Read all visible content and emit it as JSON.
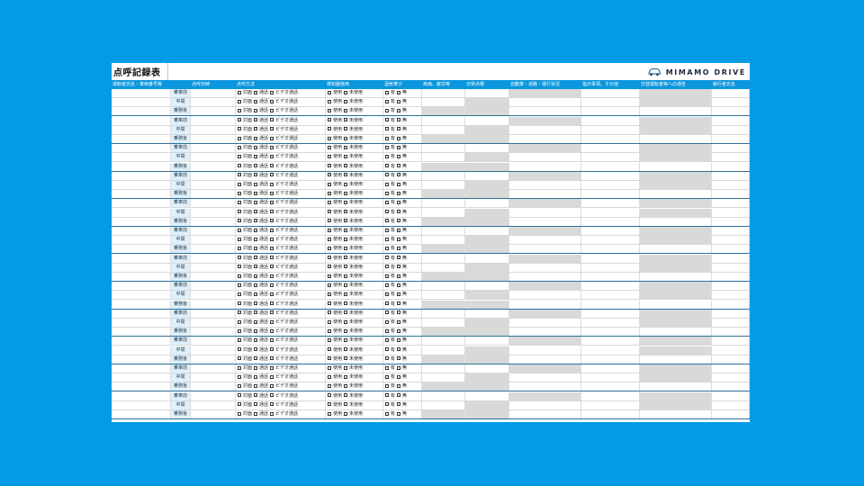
{
  "title": "点呼記録表",
  "brand": {
    "name": "MIMAMO DRIVE",
    "icon": "car-icon",
    "accent": "#1c2b3a"
  },
  "colors": {
    "background": "#049be5",
    "header": "#0b96de",
    "timing_cell": "#dff0fb",
    "gray_cell": "#d9d9d9"
  },
  "columns": [
    "運転者氏名・車両番号等",
    "点呼日時",
    "点呼方法",
    "検知器使用",
    "酒気帯び",
    "疾病、疲労等",
    "日常点検",
    "自動車・道路・運行状況",
    "指示事項、その他",
    "交替運転者等への通告",
    "執行者氏名"
  ],
  "timings": [
    "乗車前",
    "中間",
    "乗務後"
  ],
  "method_options": [
    "対面",
    "通話",
    "ビデオ通話"
  ],
  "detector_options": [
    "使用",
    "未使用"
  ],
  "alcohol_options": [
    "有",
    "無"
  ],
  "group_count": 12
}
